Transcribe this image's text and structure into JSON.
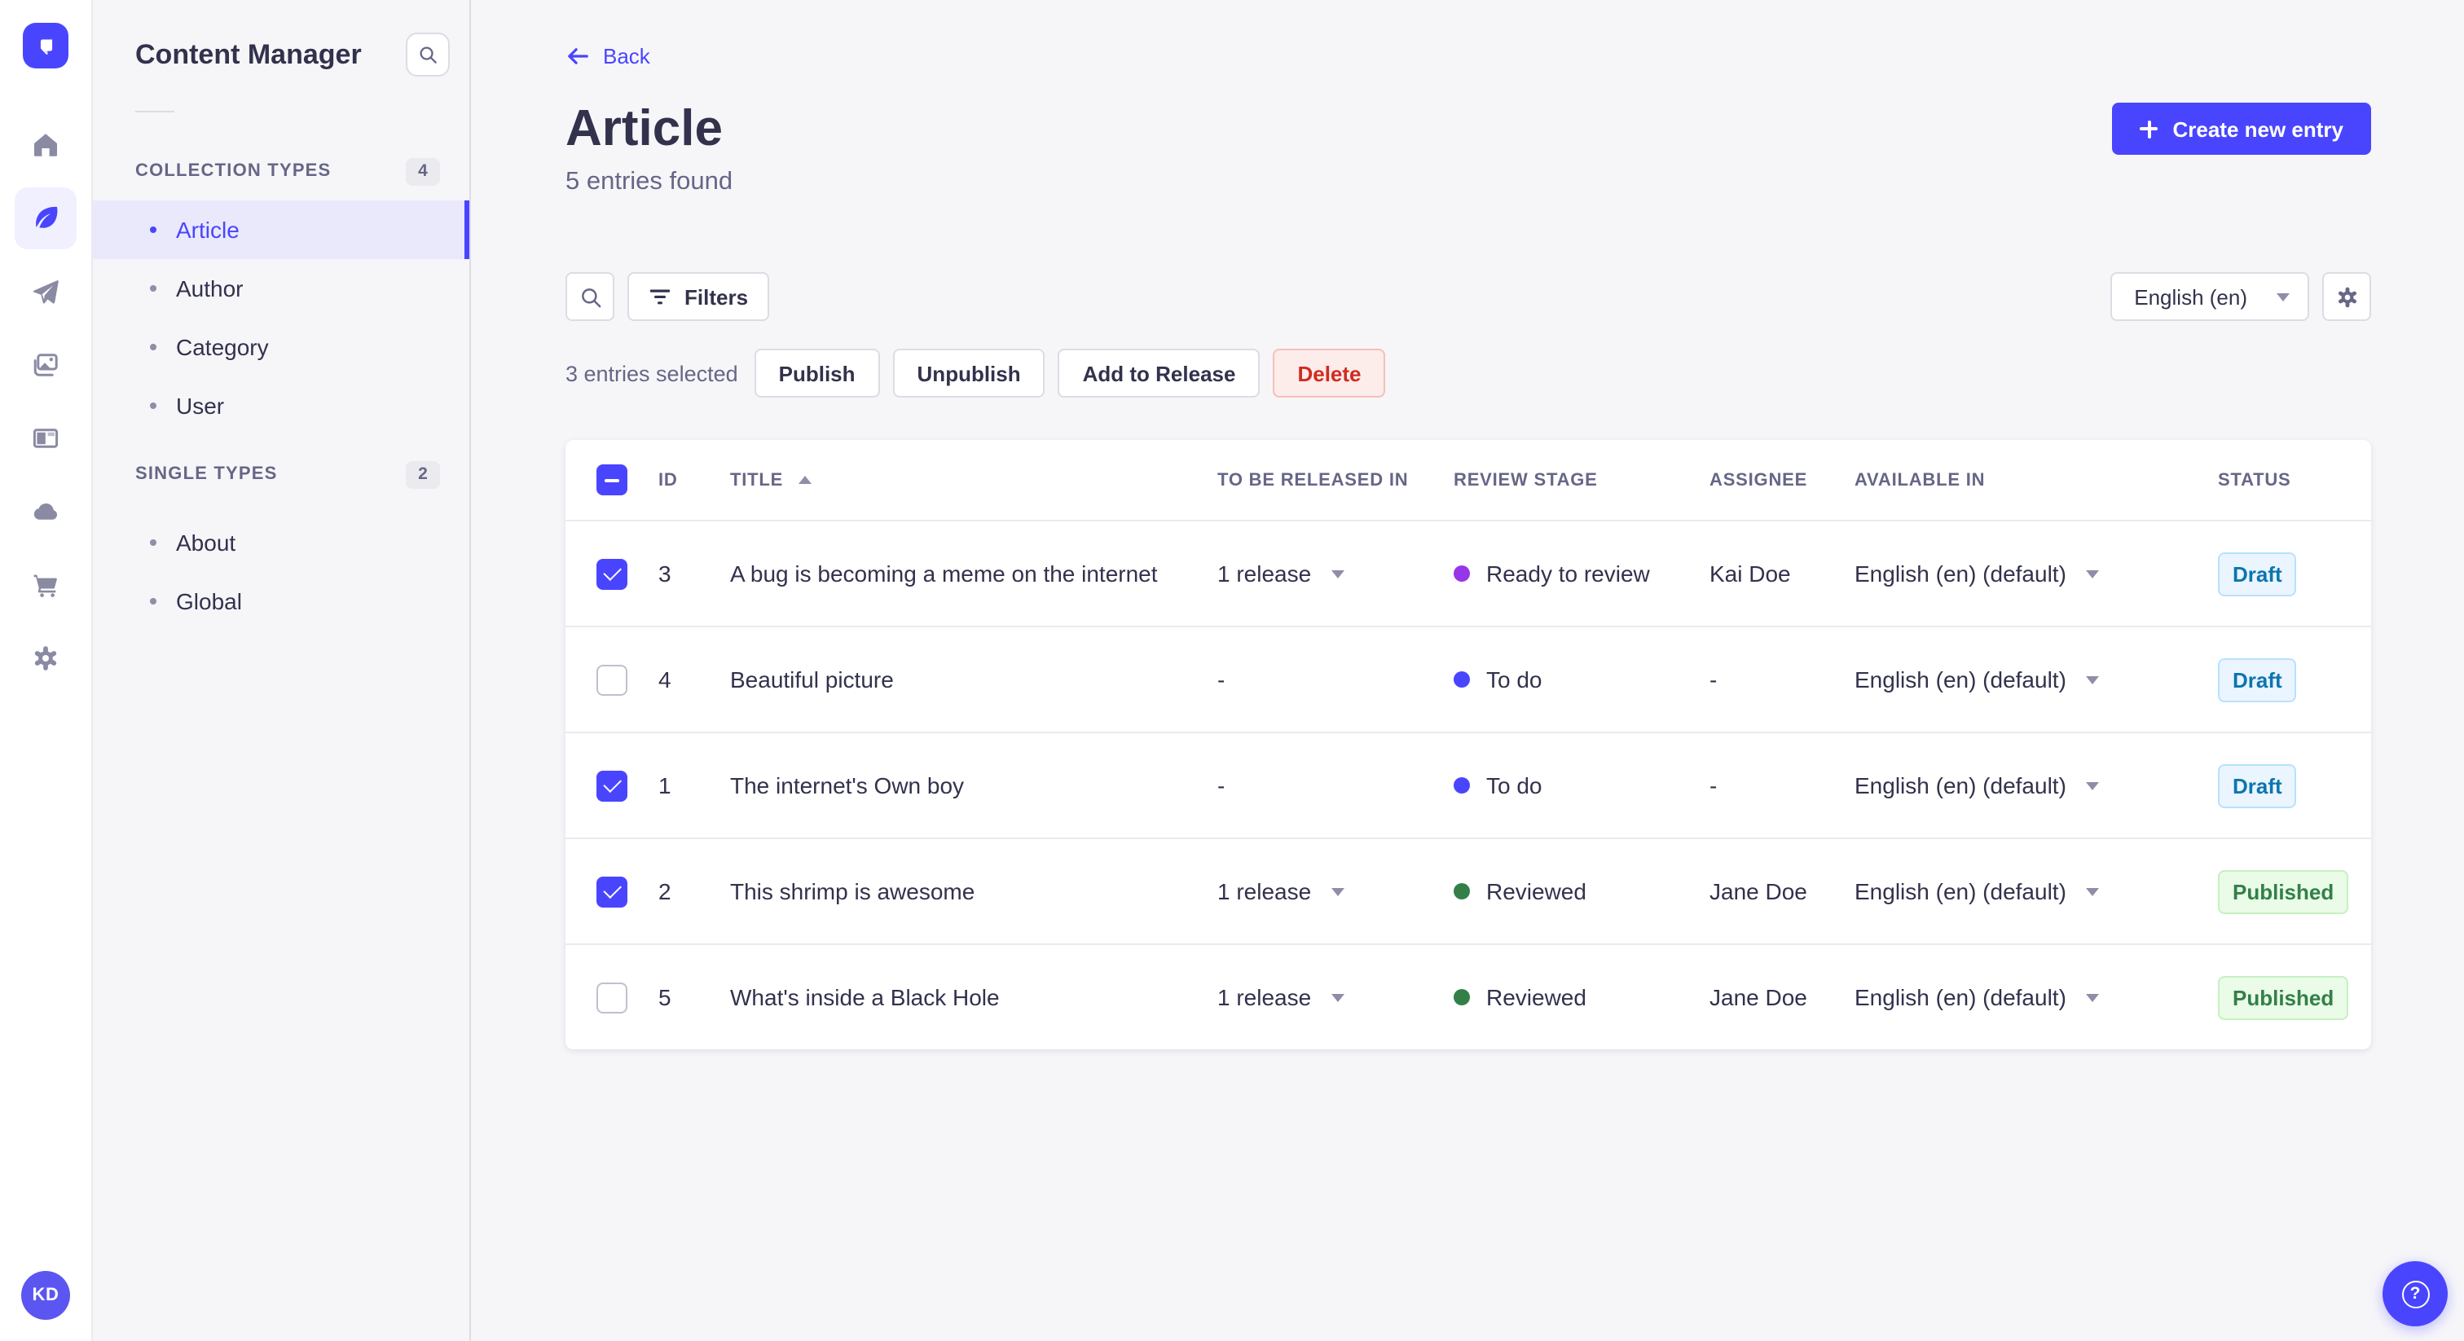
{
  "rail": {
    "icons": [
      {
        "name": "home-icon",
        "active": "false"
      },
      {
        "name": "feather-icon",
        "active": "true"
      },
      {
        "name": "paper-plane-icon",
        "active": "false"
      },
      {
        "name": "pictures-icon",
        "active": "false"
      },
      {
        "name": "layout-panel-icon",
        "active": "false"
      },
      {
        "name": "cloud-icon",
        "active": "false"
      },
      {
        "name": "shopping-cart-icon",
        "active": "false"
      },
      {
        "name": "gear-icon",
        "active": "false"
      }
    ],
    "avatar_initials": "KD"
  },
  "sidebar": {
    "app_title": "Content Manager",
    "sections": [
      {
        "label": "COLLECTION TYPES",
        "count": "4",
        "items": [
          {
            "label": "Article",
            "active": "true"
          },
          {
            "label": "Author",
            "active": "false"
          },
          {
            "label": "Category",
            "active": "false"
          },
          {
            "label": "User",
            "active": "false"
          }
        ]
      },
      {
        "label": "SINGLE TYPES",
        "count": "2",
        "items": [
          {
            "label": "About",
            "active": "false"
          },
          {
            "label": "Global",
            "active": "false"
          }
        ]
      }
    ]
  },
  "header": {
    "back_label": "Back",
    "title": "Article",
    "subtitle": "5 entries found",
    "create_button_label": "Create new entry"
  },
  "toolbar": {
    "filters_label": "Filters",
    "locale_selected": "English (en)"
  },
  "selection_bar": {
    "selected_text": "3 entries selected",
    "publish_label": "Publish",
    "unpublish_label": "Unpublish",
    "add_to_release_label": "Add to Release",
    "delete_label": "Delete"
  },
  "table": {
    "select_all_state": "indeterminate",
    "sort": {
      "column": "TITLE",
      "direction": "asc"
    },
    "headers": {
      "id": "ID",
      "title": "TITLE",
      "to_be_released_in": "TO BE RELEASED IN",
      "review_stage": "REVIEW STAGE",
      "assignee": "ASSIGNEE",
      "available_in": "AVAILABLE IN",
      "status": "STATUS"
    },
    "rows": [
      {
        "state": "checked",
        "id": "3",
        "title": "A bug is becoming a meme on the internet",
        "to_be_released_in": "1 release",
        "review_stage": "Ready to review",
        "review_stage_key": "ready",
        "assignee": "Kai Doe",
        "available_in": "English (en) (default)",
        "status": "Draft",
        "status_key": "draft"
      },
      {
        "state": "unchecked",
        "id": "4",
        "title": "Beautiful picture",
        "to_be_released_in": "-",
        "review_stage": "To do",
        "review_stage_key": "todo",
        "assignee": "-",
        "available_in": "English (en) (default)",
        "status": "Draft",
        "status_key": "draft"
      },
      {
        "state": "checked",
        "id": "1",
        "title": "The internet's Own boy",
        "to_be_released_in": "-",
        "review_stage": "To do",
        "review_stage_key": "todo",
        "assignee": "-",
        "available_in": "English (en) (default)",
        "status": "Draft",
        "status_key": "draft"
      },
      {
        "state": "checked",
        "id": "2",
        "title": "This shrimp is awesome",
        "to_be_released_in": "1 release",
        "review_stage": "Reviewed",
        "review_stage_key": "reviewed",
        "assignee": "Jane Doe",
        "available_in": "English (en) (default)",
        "status": "Published",
        "status_key": "published"
      },
      {
        "state": "unchecked",
        "id": "5",
        "title": "What's inside a Black Hole",
        "to_be_released_in": "1 release",
        "review_stage": "Reviewed",
        "review_stage_key": "reviewed",
        "assignee": "Jane Doe",
        "available_in": "English (en) (default)",
        "status": "Published",
        "status_key": "published"
      }
    ]
  },
  "fab": {
    "glyph": "?"
  },
  "colors": {
    "primary": "#4945ff",
    "active_nav_bg": "#eae9fc",
    "stage_ready": "#9736e8",
    "stage_todo": "#4945ff",
    "stage_reviewed": "#328048",
    "draft_text": "#0c75af",
    "draft_bg": "#eaf5ff",
    "published_text": "#328048",
    "published_bg": "#eafbe7",
    "danger_text": "#d02b20",
    "danger_bg": "#fcecea"
  }
}
